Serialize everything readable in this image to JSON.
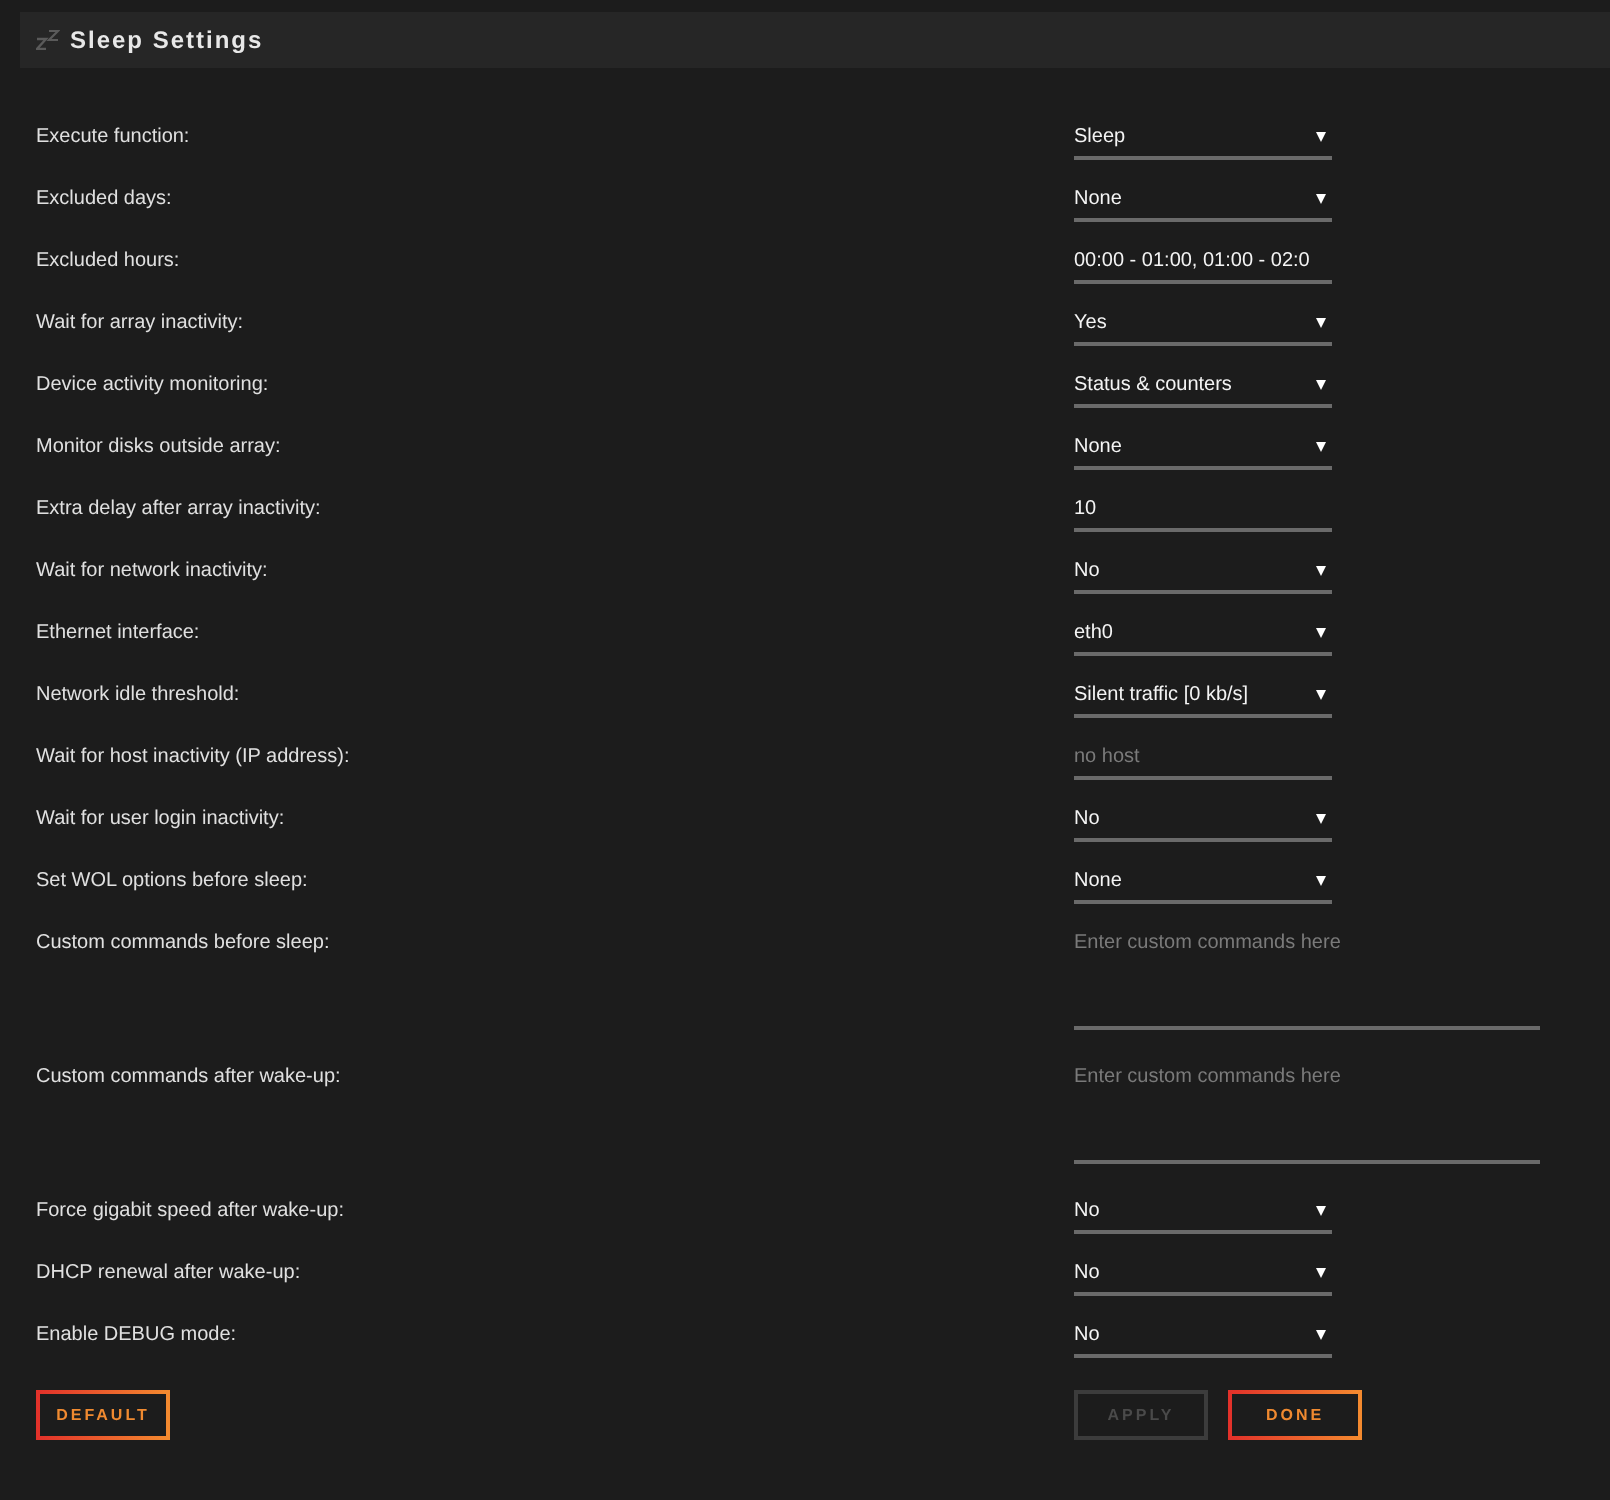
{
  "window": {
    "title": "Sleep Settings"
  },
  "settings": [
    {
      "label": "Execute function:",
      "kind": "select",
      "value": "Sleep"
    },
    {
      "label": "Excluded days:",
      "kind": "select",
      "value": "None"
    },
    {
      "label": "Excluded hours:",
      "kind": "input",
      "value": "00:00 - 01:00, 01:00 - 02:0"
    },
    {
      "label": "Wait for array inactivity:",
      "kind": "select",
      "value": "Yes"
    },
    {
      "label": "Device activity monitoring:",
      "kind": "select",
      "value": "Status & counters"
    },
    {
      "label": "Monitor disks outside array:",
      "kind": "select",
      "value": "None"
    },
    {
      "label": "Extra delay after array inactivity:",
      "kind": "input",
      "value": "10"
    },
    {
      "label": "Wait for network inactivity:",
      "kind": "select",
      "value": "No"
    },
    {
      "label": "Ethernet interface:",
      "kind": "select",
      "value": "eth0"
    },
    {
      "label": "Network idle threshold:",
      "kind": "select",
      "value": "Silent traffic [0 kb/s]"
    },
    {
      "label": "Wait for host inactivity (IP address):",
      "kind": "input",
      "placeholder": "no host"
    },
    {
      "label": "Wait for user login inactivity:",
      "kind": "select",
      "value": "No"
    },
    {
      "label": "Set WOL options before sleep:",
      "kind": "select",
      "value": "None"
    },
    {
      "label": "Custom commands before sleep:",
      "kind": "textarea",
      "placeholder": "Enter custom commands here"
    },
    {
      "label": "Custom commands after wake-up:",
      "kind": "textarea",
      "placeholder": "Enter custom commands here"
    },
    {
      "label": "Force gigabit speed after wake-up:",
      "kind": "select",
      "value": "No"
    },
    {
      "label": "DHCP renewal after wake-up:",
      "kind": "select",
      "value": "No"
    },
    {
      "label": "Enable DEBUG mode:",
      "kind": "select",
      "value": "No"
    }
  ],
  "buttons": {
    "left": [
      {
        "label": "DEFAULT",
        "disabled": false
      }
    ],
    "right": [
      {
        "label": "APPLY",
        "disabled": true
      },
      {
        "label": "DONE",
        "disabled": false
      }
    ]
  }
}
